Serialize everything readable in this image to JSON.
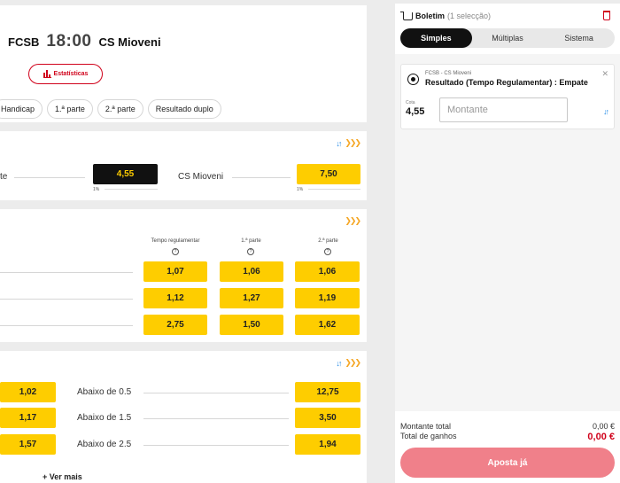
{
  "match": {
    "home": "FCSB",
    "time": "18:00",
    "away": "CS Mioveni",
    "stats_label": "Estatísticas",
    "chips": [
      "Handicap",
      "1.ª parte",
      "2.ª parte",
      "Resultado duplo"
    ]
  },
  "match_result": {
    "draw_label_fragment": "te",
    "draw_odd": "4,55",
    "draw_pct": "1%",
    "away_label": "CS Mioveni",
    "away_odd": "7,50",
    "away_pct": "1%"
  },
  "periods": {
    "columns": [
      "Tempo regulamentar",
      "1.ª parte",
      "2.ª parte"
    ],
    "rows": [
      [
        "1,07",
        "1,06",
        "1,06"
      ],
      [
        "1,12",
        "1,27",
        "1,19"
      ],
      [
        "2,75",
        "1,50",
        "1,62"
      ]
    ]
  },
  "goals": {
    "rows": [
      {
        "over_odd": "1,02",
        "under_label": "Abaixo de 0.5",
        "under_odd": "12,75"
      },
      {
        "over_odd": "1,17",
        "under_label": "Abaixo de 1.5",
        "under_odd": "3,50"
      },
      {
        "over_odd": "1,57",
        "under_label": "Abaixo de 2.5",
        "under_odd": "1,94"
      }
    ],
    "more_label": "+ Ver mais"
  },
  "betslip": {
    "title": "Boletim",
    "count": "(1 selecção)",
    "tabs": [
      "Simples",
      "Múltiplas",
      "Sistema"
    ],
    "selection": {
      "event": "FCSB - CS Mioveni",
      "market": "Resultado (Tempo Regulamentar) : Empate",
      "cota_label": "Cota",
      "cota_value": "4,55",
      "stake_placeholder": "Montante"
    },
    "total_stake_label": "Montante total",
    "total_stake_value": "0,00 €",
    "total_win_label": "Total de ganhos",
    "total_win_value": "0,00 €",
    "bet_button": "Aposta já"
  },
  "colors": {
    "odd_yellow": "#fecd00",
    "brand_red": "#d0021b",
    "bet_button": "#f0808a",
    "swap_blue": "#1e88e5",
    "arrow_orange": "#f5a623"
  }
}
